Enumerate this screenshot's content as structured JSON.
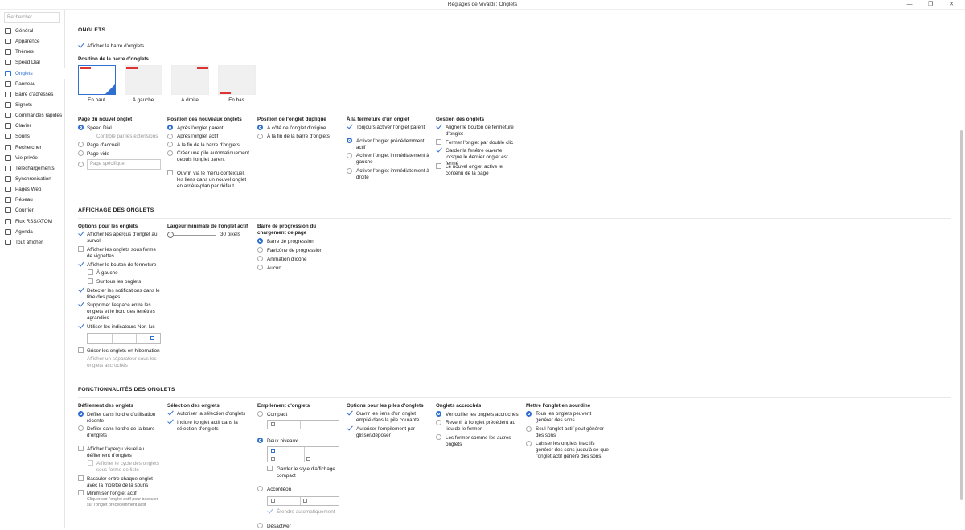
{
  "window": {
    "title": "Réglages de Vivaldi : Onglets",
    "minimize": "—",
    "restore": "❐",
    "close": "✕"
  },
  "sidebar": {
    "search_placeholder": "Rechercher",
    "items": [
      "Général",
      "Apparence",
      "Thèmes",
      "Speed Dial",
      "Onglets",
      "Panneau",
      "Barre d'adresses",
      "Signets",
      "Commandes rapides",
      "Clavier",
      "Souris",
      "Rechercher",
      "Vie privée",
      "Téléchargements",
      "Synchronisation",
      "Pages Web",
      "Réseau",
      "Courrier",
      "Flux RSS/ATOM",
      "Agenda",
      "Tout afficher"
    ],
    "active": "Onglets"
  },
  "onglets": {
    "heading": "ONGLETS",
    "show_tabbar": "Afficher la barre d'onglets",
    "position_label": "Position de la barre d'onglets",
    "positions": [
      "En haut",
      "À gauche",
      "À droite",
      "En bas"
    ],
    "new_tab_page": {
      "label": "Page du nouvel onglet",
      "options": [
        "Speed Dial",
        "Page d'accueil",
        "Page vide"
      ],
      "note": "Contrôlé par les extensions",
      "placeholder": "Page spécifique"
    },
    "new_tab_position": {
      "label": "Position des nouveaux onglets",
      "options": [
        "Après l'onglet parent",
        "Après l'onglet actif",
        "À la fin de la barre d'onglets",
        "Créer une pile automatiquement depuis l'onglet parent"
      ],
      "context_menu": "Ouvrir, via le menu contextuel, les liens dans un nouvel onglet en arrière-plan par défaut"
    },
    "duplicate_position": {
      "label": "Position de l'onglet dupliqué",
      "options": [
        "À côté de l'onglet d'origine",
        "À la fin de la barre d'onglets"
      ]
    },
    "on_close": {
      "label": "À la fermeture d'un onglet",
      "always_parent": "Toujours activer l'onglet parent",
      "options": [
        "Activer l'onglet précédemment actif",
        "Activer l'onglet immédiatement à gauche",
        "Activer l'onglet immédiatement à droite"
      ]
    },
    "management": {
      "label": "Gestion des onglets",
      "options": [
        "Aligner le bouton de fermeture d'onglet",
        "Fermer l'onglet par double clic",
        "Garder la fenêtre ouverte lorsque le dernier onglet est fermé",
        "Le nouvel onglet active le contenu de la page"
      ]
    }
  },
  "affichage": {
    "heading": "AFFICHAGE DES ONGLETS",
    "options_label": "Options pour les onglets",
    "options": [
      "Afficher les aperçus d'onglet au survol",
      "Afficher les onglets sous forme de vignettes",
      "Afficher le bouton de fermeture",
      "À gauche",
      "Sur tous les onglets",
      "Détecter les notifications dans le titre des pages",
      "Supprimer l'espace entre les onglets et le bord des fenêtres agrandies",
      "Utiliser les indicateurs Non-lus",
      "Griser les onglets en hibernation",
      "Afficher un séparateur sous les onglets accrochés"
    ],
    "min_width_label": "Largeur minimale de l'onglet actif",
    "min_width_value": "30 pixels",
    "min_width_fraction": 0.0,
    "progress_label": "Barre de progression du chargement de page",
    "progress_options": [
      "Barre de progression",
      "Favicône de progression",
      "Animation d'icône",
      "Aucun"
    ]
  },
  "fonctionnalites": {
    "heading": "FONCTIONNALITÉS DES ONGLETS",
    "cycling": {
      "label": "Défilement des onglets",
      "options": [
        "Défiler dans l'ordre d'utilisation récente",
        "Défiler dans l'ordre de la barre d'onglets"
      ],
      "visual": "Afficher l'aperçu visuel au défilement d'onglets",
      "visual_sub": "Afficher le cycle des onglets sous forme de liste",
      "wheel": "Basculer entre chaque onglet avec la molette de la souris",
      "minimize": "Minimiser l'onglet actif",
      "minimize_note": "Cliquer sur l'onglet actif pour basculer sur l'onglet précédemment actif"
    },
    "selection": {
      "label": "Sélection des onglets",
      "options": [
        "Autoriser la sélection d'onglets",
        "Inclure l'onglet actif dans la sélection d'onglets"
      ]
    },
    "stacking": {
      "label": "Empilement d'onglets",
      "options": [
        "Compact",
        "Deux niveaux",
        "Accordéon",
        "Désactiver"
      ],
      "compact_style": "Garder le style d'affichage compact",
      "auto_expand": "Étendre automatiquement"
    },
    "stack_options": {
      "label": "Options pour les piles d'onglets",
      "options": [
        "Ouvrir les liens d'un onglet empilé dans la pile courante",
        "Autoriser l'empilement par glisser/déposer"
      ]
    },
    "pinned": {
      "label": "Onglets accrochés",
      "options": [
        "Verrouiller les onglets accrochés",
        "Revenir à l'onglet précédent au lieu de le fermer",
        "Les fermer comme les autres onglets"
      ]
    },
    "mute": {
      "label": "Mettre l'onglet en sourdine",
      "options": [
        "Tous les onglets peuvent générer des sons",
        "Seul l'onglet actif peut générer des sons",
        "Laisser les onglets inactifs générer des sons jusqu'à ce que l'onglet actif génère des sons"
      ]
    }
  }
}
